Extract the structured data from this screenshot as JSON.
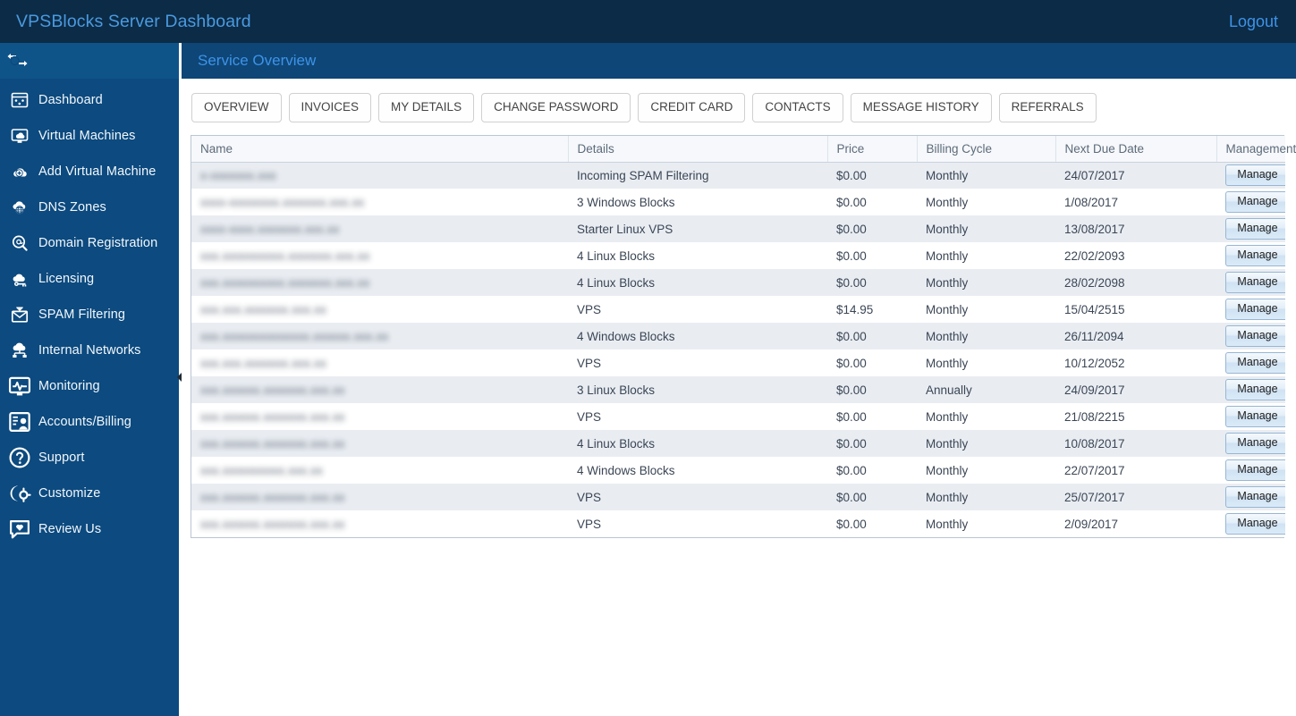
{
  "titlebar": {
    "title": "VPSBlocks Server Dashboard",
    "logout_label": "Logout"
  },
  "colors": {
    "titlebar_bg": "#0c2b46",
    "sidebar_bg": "#0c4a7f",
    "page_head_bg": "#0e4677",
    "accent_link": "#3d93e8",
    "row_stripe": "#e9edf2",
    "table_border": "#b9c6d2"
  },
  "sidebar": {
    "toggle_icon": "collapse-expand-arrows-icon",
    "collapse_handle_icon": "chevron-left-icon",
    "items": [
      {
        "label": "Dashboard",
        "icon": "dashboard-icon"
      },
      {
        "label": "Virtual Machines",
        "icon": "monitor-cloud-icon"
      },
      {
        "label": "Add Virtual Machine",
        "icon": "cloud-plus-icon"
      },
      {
        "label": "DNS Zones",
        "icon": "globe-icon"
      },
      {
        "label": "Domain Registration",
        "icon": "magnifier-at-icon"
      },
      {
        "label": "Licensing",
        "icon": "license-key-icon"
      },
      {
        "label": "SPAM Filtering",
        "icon": "envelope-filter-icon"
      },
      {
        "label": "Internal Networks",
        "icon": "network-cloud-icon"
      },
      {
        "label": "Monitoring",
        "icon": "heartbeat-monitor-icon"
      },
      {
        "label": "Accounts/Billing",
        "icon": "account-billing-icon"
      },
      {
        "label": "Support",
        "icon": "question-circle-icon"
      },
      {
        "label": "Customize",
        "icon": "customize-gear-icon"
      },
      {
        "label": "Review Us",
        "icon": "review-speech-bubble-icon"
      }
    ]
  },
  "page": {
    "title": "Service Overview",
    "tabs": [
      "OVERVIEW",
      "INVOICES",
      "MY DETAILS",
      "CHANGE PASSWORD",
      "CREDIT CARD",
      "CONTACTS",
      "MESSAGE HISTORY",
      "REFERRALS"
    ]
  },
  "table": {
    "columns": [
      "Name",
      "Details",
      "Price",
      "Billing Cycle",
      "Next Due Date",
      "Management"
    ],
    "manage_label": "Manage",
    "rows": [
      {
        "name": "x-xxxxxxx.xxx",
        "details": "Incoming SPAM Filtering",
        "price": "$0.00",
        "cycle": "Monthly",
        "due": "24/07/2017"
      },
      {
        "name": "xxxx-xxxxxxxx.xxxxxxx.xxx.xx",
        "details": "3 Windows Blocks",
        "price": "$0.00",
        "cycle": "Monthly",
        "due": "1/08/2017"
      },
      {
        "name": "xxxx-xxxx.xxxxxxx.xxx.xx",
        "details": "Starter Linux VPS",
        "price": "$0.00",
        "cycle": "Monthly",
        "due": "13/08/2017"
      },
      {
        "name": "xxx.xxxxxxxxxx.xxxxxxx.xxx.xx",
        "details": "4 Linux Blocks",
        "price": "$0.00",
        "cycle": "Monthly",
        "due": "22/02/2093"
      },
      {
        "name": "xxx.xxxxxxxxxx.xxxxxxx.xxx.xx",
        "details": "4 Linux Blocks",
        "price": "$0.00",
        "cycle": "Monthly",
        "due": "28/02/2098"
      },
      {
        "name": "xxx.xxx.xxxxxxx.xxx.xx",
        "details": "VPS",
        "price": "$14.95",
        "cycle": "Monthly",
        "due": "15/04/2515"
      },
      {
        "name": "xxx.xxxxxxxxxxxxxx.xxxxxx.xxx.xx",
        "details": "4 Windows Blocks",
        "price": "$0.00",
        "cycle": "Monthly",
        "due": "26/11/2094"
      },
      {
        "name": "xxx.xxx.xxxxxxx.xxx.xx",
        "details": "VPS",
        "price": "$0.00",
        "cycle": "Monthly",
        "due": "10/12/2052"
      },
      {
        "name": "xxx.xxxxxx.xxxxxxx.xxx.xx",
        "details": "3 Linux Blocks",
        "price": "$0.00",
        "cycle": "Annually",
        "due": "24/09/2017"
      },
      {
        "name": "xxx.xxxxxx.xxxxxxx.xxx.xx",
        "details": "VPS",
        "price": "$0.00",
        "cycle": "Monthly",
        "due": "21/08/2215"
      },
      {
        "name": "xxx.xxxxxx.xxxxxxx.xxx.xx",
        "details": "4 Linux Blocks",
        "price": "$0.00",
        "cycle": "Monthly",
        "due": "10/08/2017"
      },
      {
        "name": "xxx.xxxxxxxxxx.xxx.xx",
        "details": "4 Windows Blocks",
        "price": "$0.00",
        "cycle": "Monthly",
        "due": "22/07/2017"
      },
      {
        "name": "xxx.xxxxxx.xxxxxxx.xxx.xx",
        "details": "VPS",
        "price": "$0.00",
        "cycle": "Monthly",
        "due": "25/07/2017"
      },
      {
        "name": "xxx.xxxxxx.xxxxxxx.xxx.xx",
        "details": "VPS",
        "price": "$0.00",
        "cycle": "Monthly",
        "due": "2/09/2017"
      }
    ]
  }
}
